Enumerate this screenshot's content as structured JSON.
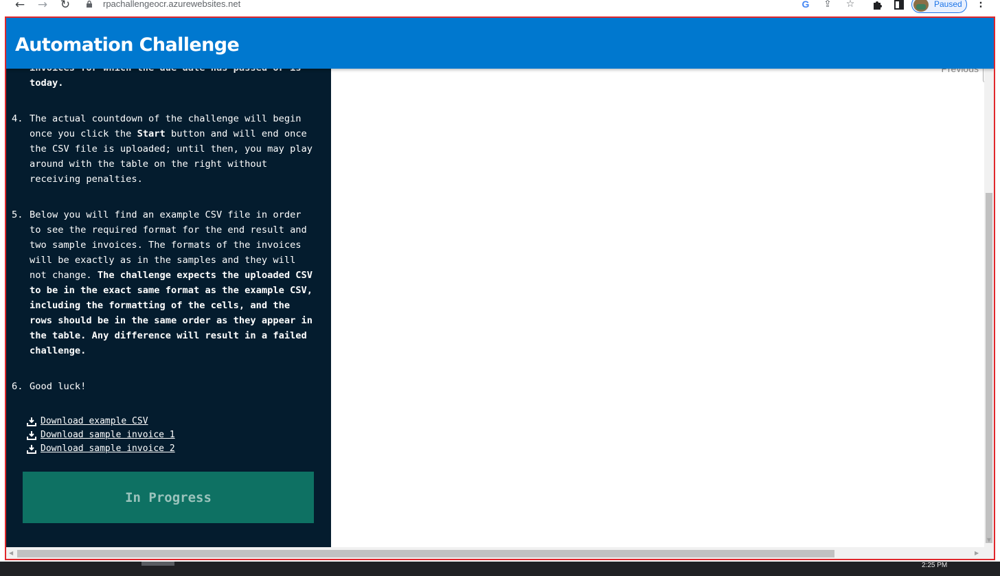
{
  "browser": {
    "url": "rpachallengeocr.azurewebsites.net",
    "profile_status": "Paused",
    "icons": [
      "back-arrow-icon",
      "forward-arrow-icon",
      "reload-icon",
      "lock-icon",
      "google-icon",
      "share-icon",
      "star-icon",
      "extensions-icon",
      "side-panel-icon",
      "menu-icon"
    ]
  },
  "app": {
    "title": "Automation Challenge"
  },
  "sidebar": {
    "partial_line_top": "invoices for which the due date has passed or is",
    "instructions": [
      {
        "number": "",
        "text": "today."
      },
      {
        "number": "4.",
        "text_parts": [
          "The actual countdown of the challenge will begin once you click the ",
          "Start",
          " button and will end once the CSV file is uploaded; until then, you may play around with the table on the right without receiving penalties."
        ]
      },
      {
        "number": "5.",
        "text_parts": [
          "Below you will find an example CSV file in order to see the required format for the end result and two sample invoices. The formats of the invoices will be exactly as in the samples and they will not change. ",
          "The challenge expects the uploaded CSV to be in the exact same format as the example CSV, including the formatting of the cells, and the rows should be in the same order as they appear in the table. Any difference will result in a failed challenge."
        ]
      },
      {
        "number": "6.",
        "text": "Good luck!"
      }
    ],
    "downloads": [
      {
        "label": " Download example CSV",
        "icon": "download-icon"
      },
      {
        "label": " Download sample invoice 1",
        "icon": "download-icon"
      },
      {
        "label": " Download sample invoice 2",
        "icon": "download-icon"
      }
    ],
    "status_button": "In Progress"
  },
  "content": {
    "pagination_label": "Previous"
  },
  "taskbar": {
    "time": "2:25 PM"
  }
}
